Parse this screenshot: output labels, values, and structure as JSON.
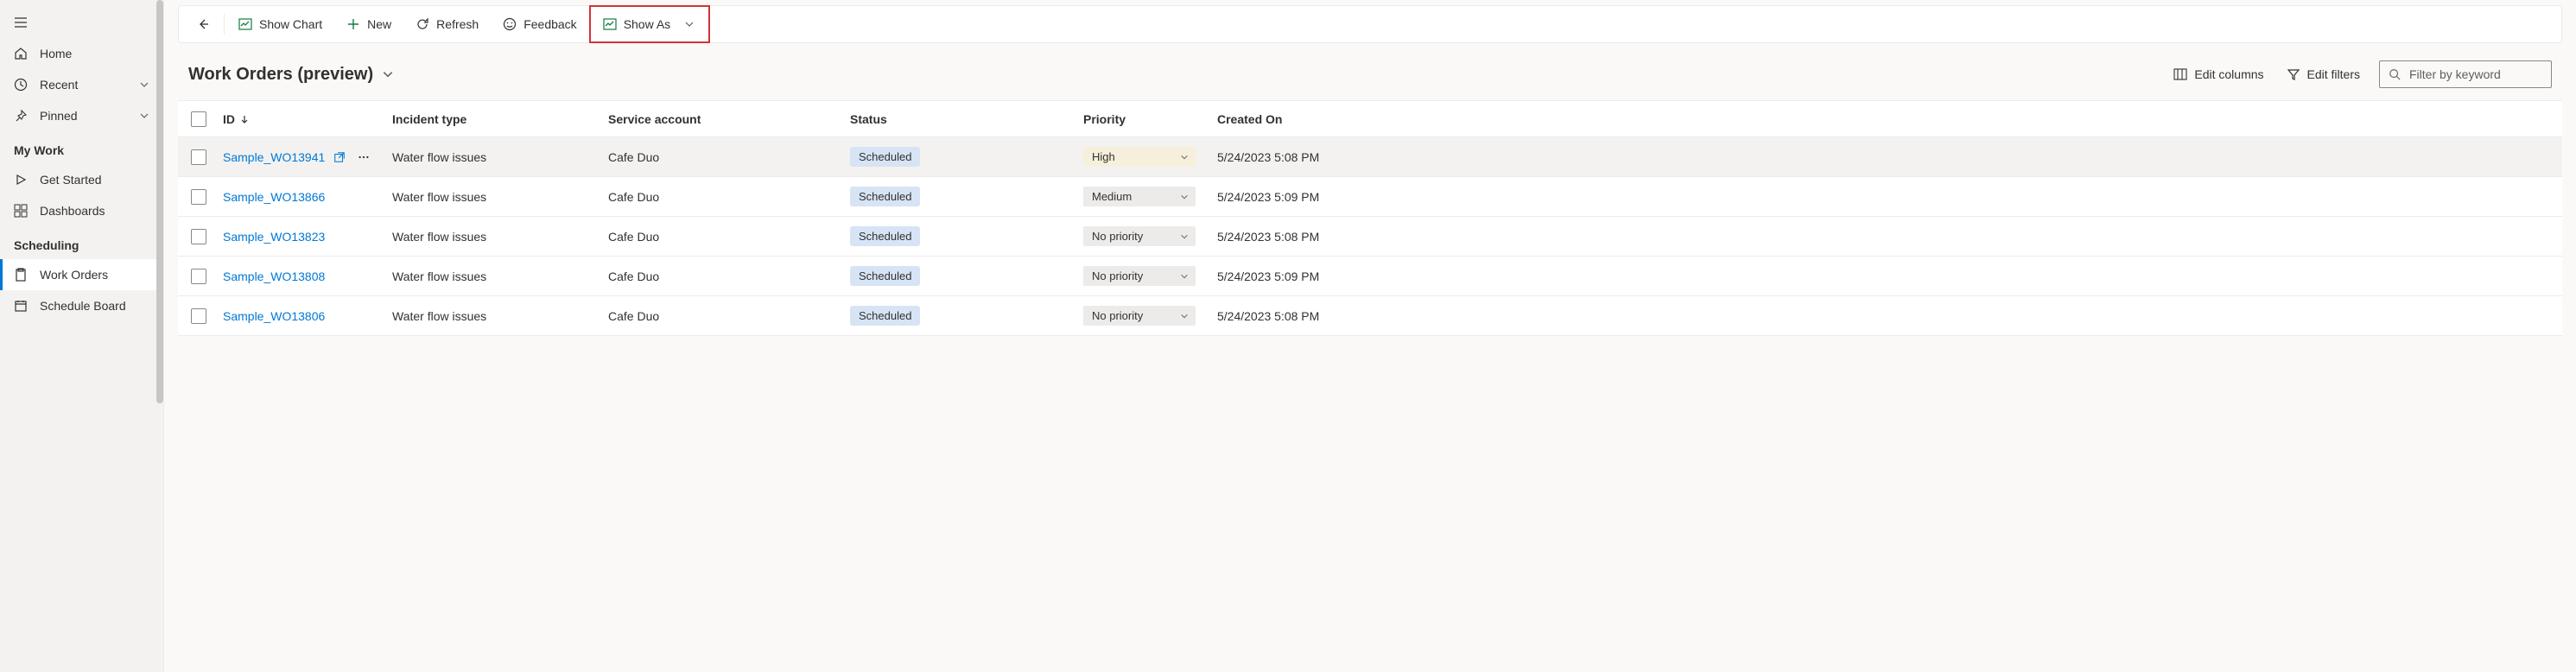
{
  "sidebar": {
    "top": [
      {
        "icon": "home",
        "label": "Home"
      },
      {
        "icon": "clock",
        "label": "Recent",
        "chevron": true
      },
      {
        "icon": "pin",
        "label": "Pinned",
        "chevron": true
      }
    ],
    "sec_mywork": {
      "header": "My Work",
      "items": [
        {
          "icon": "play",
          "label": "Get Started"
        },
        {
          "icon": "grid4",
          "label": "Dashboards"
        }
      ]
    },
    "sec_sched": {
      "header": "Scheduling",
      "items": [
        {
          "icon": "clipboard",
          "label": "Work Orders",
          "selected": true
        },
        {
          "icon": "calendar",
          "label": "Schedule Board"
        }
      ]
    }
  },
  "commandbar": {
    "show_chart": "Show Chart",
    "new": "New",
    "refresh": "Refresh",
    "feedback": "Feedback",
    "show_as": "Show As"
  },
  "view": {
    "title": "Work Orders (preview)",
    "edit_columns": "Edit columns",
    "edit_filters": "Edit filters",
    "filter_placeholder": "Filter by keyword"
  },
  "grid": {
    "headers": {
      "id": "ID",
      "incident": "Incident type",
      "service": "Service account",
      "status": "Status",
      "priority": "Priority",
      "created": "Created On"
    },
    "rows": [
      {
        "id": "Sample_WO13941",
        "incident": "Water flow issues",
        "service": "Cafe Duo",
        "status": "Scheduled",
        "priority": "High",
        "priority_class": "high",
        "created": "5/24/2023 5:08 PM",
        "hovered": true
      },
      {
        "id": "Sample_WO13866",
        "incident": "Water flow issues",
        "service": "Cafe Duo",
        "status": "Scheduled",
        "priority": "Medium",
        "priority_class": "",
        "created": "5/24/2023 5:09 PM"
      },
      {
        "id": "Sample_WO13823",
        "incident": "Water flow issues",
        "service": "Cafe Duo",
        "status": "Scheduled",
        "priority": "No priority",
        "priority_class": "",
        "created": "5/24/2023 5:08 PM"
      },
      {
        "id": "Sample_WO13808",
        "incident": "Water flow issues",
        "service": "Cafe Duo",
        "status": "Scheduled",
        "priority": "No priority",
        "priority_class": "",
        "created": "5/24/2023 5:09 PM"
      },
      {
        "id": "Sample_WO13806",
        "incident": "Water flow issues",
        "service": "Cafe Duo",
        "status": "Scheduled",
        "priority": "No priority",
        "priority_class": "",
        "created": "5/24/2023 5:08 PM"
      }
    ]
  }
}
